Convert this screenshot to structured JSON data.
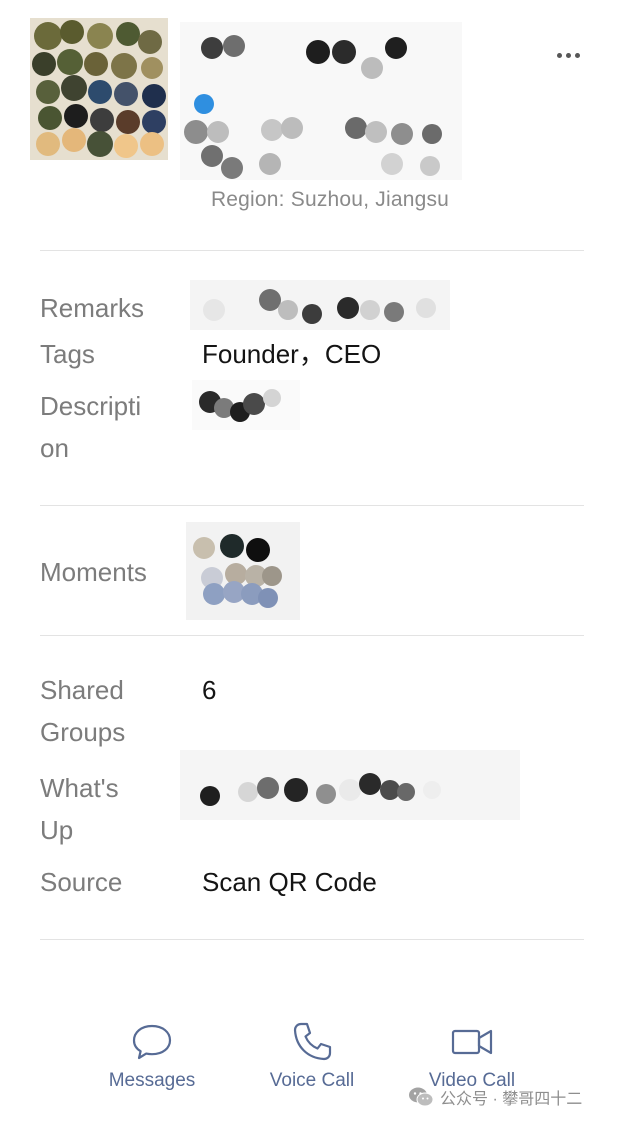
{
  "header": {
    "avatar_alt": "pixelated profile photo",
    "name_alt": "pixelated contact name",
    "more_icon": "more-horizontal-icon"
  },
  "region": {
    "label": "Region: ",
    "value": "Suzhou, Jiangsu"
  },
  "details": {
    "remarks_label": "Remarks",
    "tags_label": "Tags",
    "tags_value": "Founder，CEO",
    "description_label_1": "Descripti",
    "description_label_2": "on"
  },
  "moments": {
    "label": "Moments"
  },
  "info": {
    "shared_groups_label_1": "Shared",
    "shared_groups_label_2": "Groups",
    "shared_groups_value": "6",
    "whats_up_label_1": "What's",
    "whats_up_label_2": "Up",
    "source_label": "Source",
    "source_value": "Scan QR Code"
  },
  "actions": {
    "messages": {
      "label": "Messages",
      "icon": "chat-bubble-icon"
    },
    "voice_call": {
      "label": "Voice Call",
      "icon": "phone-icon"
    },
    "video_call": {
      "label": "Video Call",
      "icon": "video-camera-icon"
    }
  },
  "watermark": {
    "text": "公众号 · 攀哥四十二",
    "icon": "wechat-icon"
  },
  "colors": {
    "accent": "#576b95",
    "label_gray": "#7c7c7c",
    "divider": "#e3e3e3"
  }
}
